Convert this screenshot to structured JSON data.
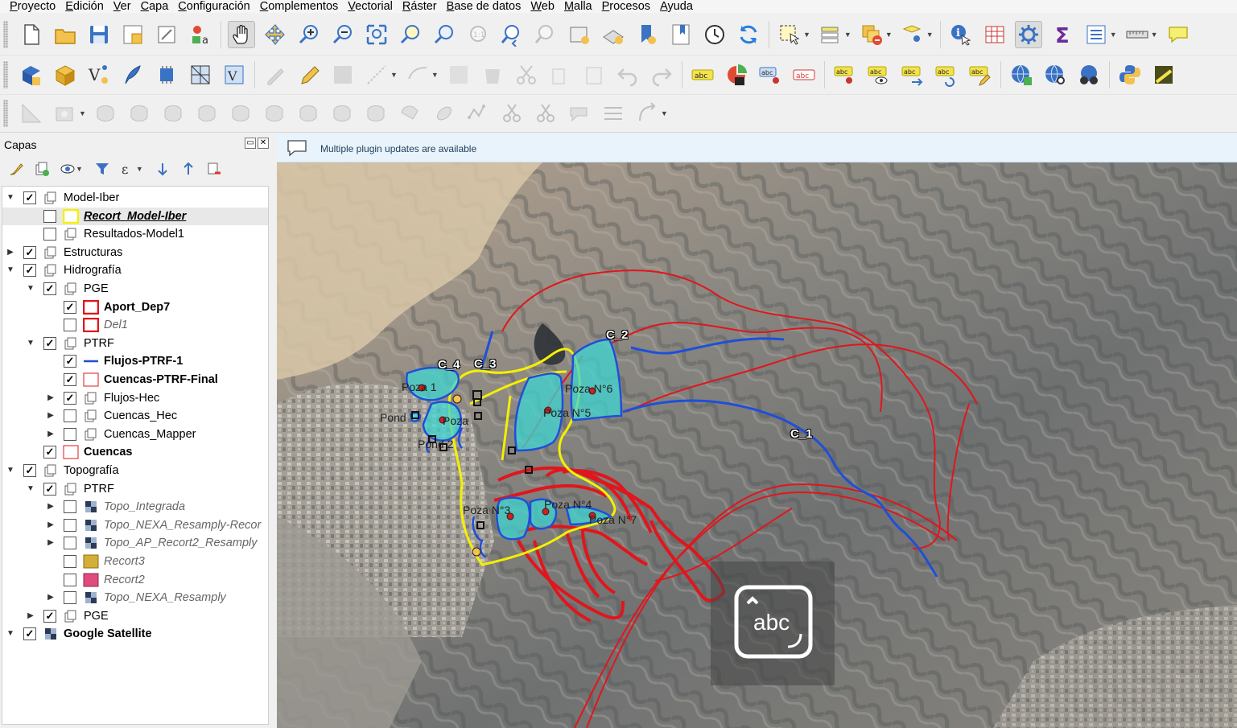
{
  "menu": [
    "Proyecto",
    "Edición",
    "Ver",
    "Capa",
    "Configuración",
    "Complementos",
    "Vectorial",
    "Ráster",
    "Base de datos",
    "Web",
    "Malla",
    "Procesos",
    "Ayuda"
  ],
  "layers_panel": {
    "title": "Capas",
    "tree": [
      {
        "label": "Model-Iber",
        "style": "normal",
        "checked": true,
        "expander": "open",
        "icon": "group-icon"
      },
      {
        "label": "Recort_Model-Iber",
        "style": "bolditalic",
        "checked": false,
        "expander": "none",
        "icon": "yellow-polygon-icon",
        "selected": true
      },
      {
        "label": "Resultados-Model1",
        "style": "normal",
        "checked": false,
        "expander": "none",
        "icon": "group-icon"
      },
      {
        "label": "Estructuras",
        "style": "normal",
        "checked": true,
        "expander": "closed",
        "icon": "group-icon"
      },
      {
        "label": "Hidrografía",
        "style": "normal",
        "checked": true,
        "expander": "open",
        "icon": "group-icon"
      },
      {
        "label": "PGE",
        "style": "normal",
        "checked": true,
        "expander": "open",
        "icon": "group-icon"
      },
      {
        "label": "Aport_Dep7",
        "style": "bold",
        "checked": true,
        "expander": "none",
        "icon": "red-polygon-icon"
      },
      {
        "label": "Del1",
        "style": "italic",
        "checked": false,
        "expander": "none",
        "icon": "red-polygon-icon"
      },
      {
        "label": "PTRF",
        "style": "normal",
        "checked": true,
        "expander": "open",
        "icon": "group-icon"
      },
      {
        "label": "Flujos-PTRF-1",
        "style": "bold",
        "checked": true,
        "expander": "none",
        "icon": "blue-line-icon"
      },
      {
        "label": "Cuencas-PTRF-Final",
        "style": "bold",
        "checked": true,
        "expander": "none",
        "icon": "light-red-polygon-icon"
      },
      {
        "label": "Flujos-Hec",
        "style": "normal",
        "checked": true,
        "expander": "closed",
        "icon": "group-icon"
      },
      {
        "label": "Cuencas_Hec",
        "style": "normal",
        "checked": false,
        "expander": "closed",
        "icon": "group-icon"
      },
      {
        "label": "Cuencas_Mapper",
        "style": "normal",
        "checked": false,
        "expander": "closed",
        "icon": "group-icon"
      },
      {
        "label": "Cuencas",
        "style": "bold",
        "checked": true,
        "expander": "none",
        "icon": "light-red-polygon-icon"
      },
      {
        "label": "Topografía",
        "style": "normal",
        "checked": true,
        "expander": "open",
        "icon": "group-icon"
      },
      {
        "label": "PTRF",
        "style": "normal",
        "checked": true,
        "expander": "open",
        "icon": "group-icon"
      },
      {
        "label": "Topo_Integrada",
        "style": "italic",
        "checked": false,
        "expander": "closed",
        "icon": "raster-icon"
      },
      {
        "label": "Topo_NEXA_Resamply-Recor",
        "style": "italic",
        "checked": false,
        "expander": "closed",
        "icon": "raster-icon"
      },
      {
        "label": "Topo_AP_Recort2_Resamply",
        "style": "italic",
        "checked": false,
        "expander": "closed",
        "icon": "raster-icon"
      },
      {
        "label": "Recort3",
        "style": "italic",
        "checked": false,
        "expander": "none",
        "icon": "gold-polygon-icon"
      },
      {
        "label": "Recort2",
        "style": "italic",
        "checked": false,
        "expander": "none",
        "icon": "pink-polygon-icon"
      },
      {
        "label": "Topo_NEXA_Resamply",
        "style": "italic",
        "checked": false,
        "expander": "closed",
        "icon": "raster-icon"
      },
      {
        "label": "PGE",
        "style": "normal",
        "checked": true,
        "expander": "closed",
        "icon": "group-icon"
      },
      {
        "label": "Google Satellite",
        "style": "bold",
        "checked": true,
        "expander": "open",
        "icon": "raster-icon"
      }
    ]
  },
  "message_bar": {
    "text": "Multiple plugin updates are available"
  },
  "map": {
    "labels": [
      "Poza 1",
      "Pond",
      "Poza",
      "Pond 2",
      "Poza N°6",
      "Poza N°5",
      "Poza N°3",
      "Poza N°4",
      "Poza N°7"
    ],
    "channel_labels": [
      "C_4",
      "C_3",
      "C_2",
      "C_1"
    ],
    "overlay_text": "abc"
  },
  "colors": {
    "basin_red": "#e0161c",
    "flow_blue": "#1f4fd8",
    "pond_cyan": "#3fd6d2",
    "boundary_yellow": "#f5f000"
  }
}
